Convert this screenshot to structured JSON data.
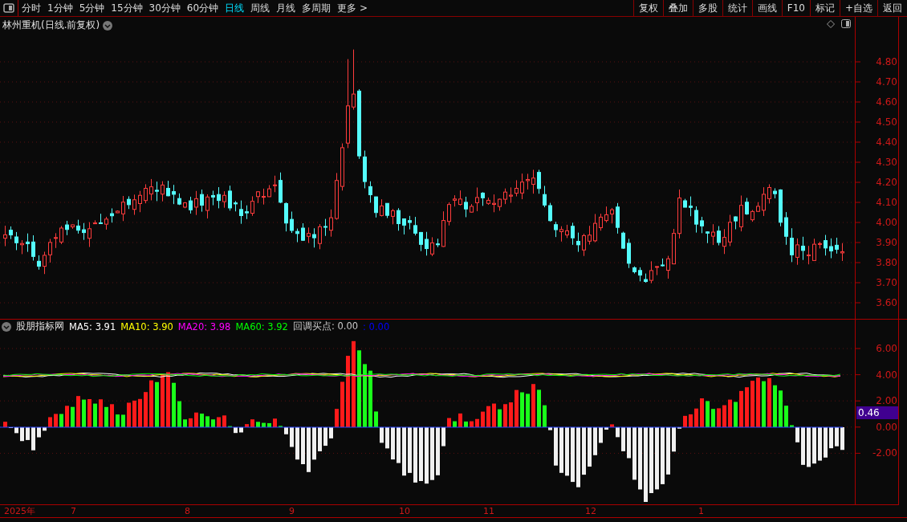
{
  "toolbar": {
    "periods": [
      {
        "label": "分时",
        "selected": false
      },
      {
        "label": "1分钟",
        "selected": false
      },
      {
        "label": "5分钟",
        "selected": false
      },
      {
        "label": "15分钟",
        "selected": false
      },
      {
        "label": "30分钟",
        "selected": false
      },
      {
        "label": "60分钟",
        "selected": false
      },
      {
        "label": "日线",
        "selected": true
      },
      {
        "label": "周线",
        "selected": false
      },
      {
        "label": "月线",
        "selected": false
      },
      {
        "label": "多周期",
        "selected": false
      }
    ],
    "more": {
      "label": "更多",
      "caret": ">"
    },
    "actions": [
      "复权",
      "叠加",
      "多股",
      "统计",
      "画线",
      "F10",
      "标记",
      "+自选",
      "返回"
    ]
  },
  "chart": {
    "title": "林州重机(日线.前复权)",
    "price_ticks": [
      "4.80",
      "4.70",
      "4.60",
      "4.50",
      "4.40",
      "4.30",
      "4.20",
      "4.10",
      "4.00",
      "3.90",
      "3.80",
      "3.70",
      "3.60"
    ]
  },
  "indicator": {
    "name": "股朋指标网",
    "values": [
      {
        "label": "MA5: 3.91",
        "color": "#ffffff"
      },
      {
        "label": "MA10: 3.90",
        "color": "#ffff00"
      },
      {
        "label": "MA20: 3.98",
        "color": "#ff00ff"
      },
      {
        "label": "MA60: 3.92",
        "color": "#00ff00"
      },
      {
        "label": "回调买点: 0.00",
        "color": "#c8c8c8"
      },
      {
        "label": ": 0.00",
        "color": "#0000ff"
      }
    ],
    "ticks": [
      "6.00",
      "4.00",
      "2.00",
      "0.00",
      "-2.00"
    ],
    "current_value": "0.46"
  },
  "time_axis": [
    "2025年",
    "7",
    "8",
    "9",
    "10",
    "11",
    "12",
    "1"
  ]
}
